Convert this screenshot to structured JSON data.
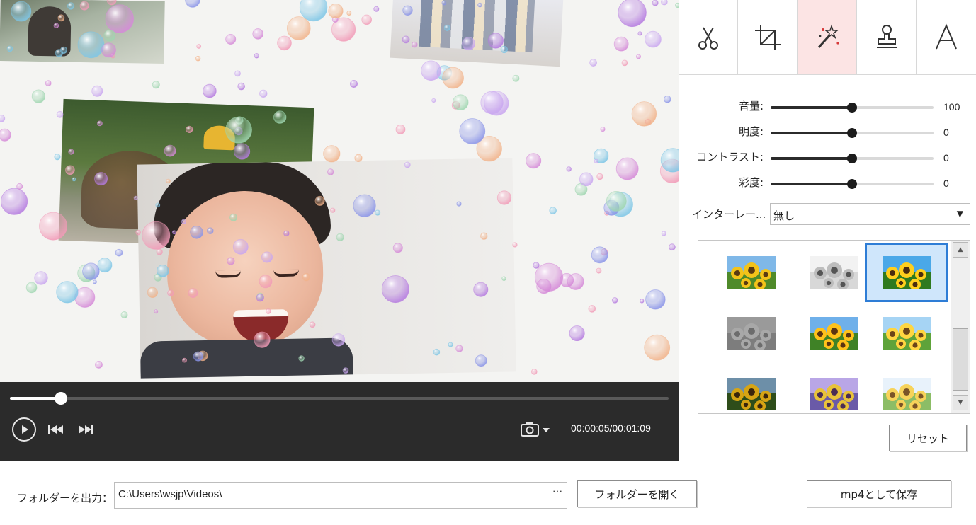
{
  "player": {
    "progress": 0.077,
    "time": "00:00:05/00:01:09"
  },
  "toolbar": {
    "tabs": [
      {
        "id": "trim",
        "icon": "scissors-icon",
        "active": false
      },
      {
        "id": "crop",
        "icon": "crop-icon",
        "active": false
      },
      {
        "id": "effects",
        "icon": "magic-wand-icon",
        "active": true
      },
      {
        "id": "watermark",
        "icon": "stamp-icon",
        "active": false
      },
      {
        "id": "text",
        "icon": "text-icon",
        "active": false
      }
    ]
  },
  "adjustments": [
    {
      "label": "音量:",
      "value": "100",
      "level": 0.5
    },
    {
      "label": "明度:",
      "value": "0",
      "level": 0.5
    },
    {
      "label": "コントラスト:",
      "value": "0",
      "level": 0.5
    },
    {
      "label": "彩度:",
      "value": "0",
      "level": 0.5
    }
  ],
  "interlace": {
    "label": "インターレー...",
    "value": "無し"
  },
  "filters": {
    "selected_index": 2,
    "items": [
      "normal",
      "sketch",
      "vivid",
      "emboss",
      "warm",
      "bright",
      "dark",
      "purple",
      "soft"
    ]
  },
  "buttons": {
    "reset": "リセット",
    "open_folder": "フォルダーを開く",
    "save": "mp4として保存"
  },
  "output": {
    "label": "フォルダーを出力：",
    "path": "C:\\Users\\wsjp\\Videos\\",
    "browse": "···"
  },
  "colors": {
    "active_tab": "#fce4e4",
    "selection": "#2e7dd6",
    "player_bg": "#2b2b2b"
  }
}
